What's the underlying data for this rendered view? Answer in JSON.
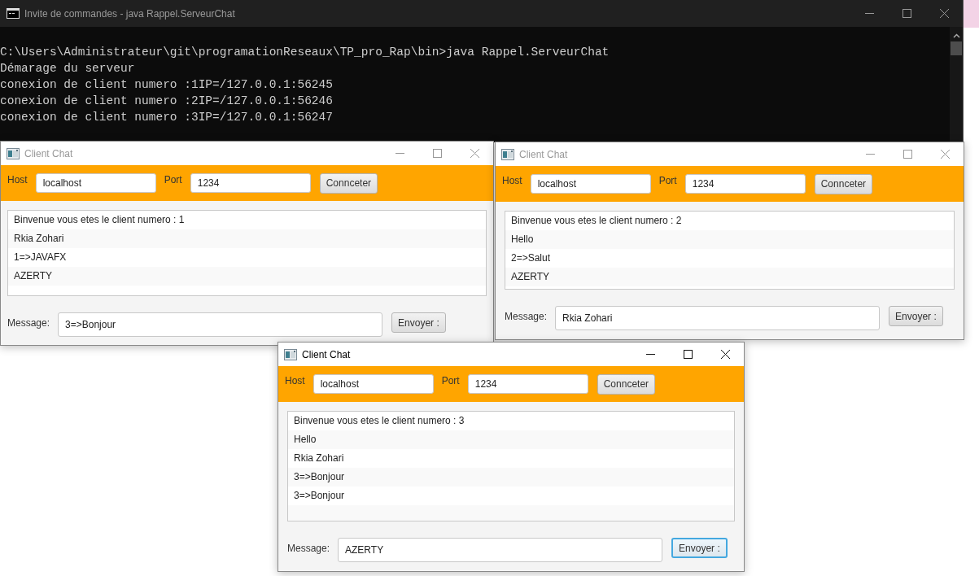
{
  "console": {
    "title": "Invite de commandes - java  Rappel.ServeurChat",
    "lines": [
      "C:\\Users\\Administrateur\\git\\programationReseaux\\TP_pro_Rap\\bin>java Rappel.ServeurChat",
      "Démarage du serveur",
      "conexion de client numero :1IP=/127.0.0.1:56245",
      "conexion de client numero :2IP=/127.0.0.1:56246",
      "conexion de client numero :3IP=/127.0.0.1:56247"
    ]
  },
  "windows": [
    {
      "title": "Client Chat",
      "active": false,
      "host_label": "Host",
      "host": "localhost",
      "port_label": "Port",
      "port": "1234",
      "connect_button": "Connceter",
      "messages": [
        "Binvenue vous etes le client numero : 1",
        "Rkia Zohari",
        "1=>JAVAFX",
        "AZERTY"
      ],
      "message_label": "Message:",
      "message": "3=>Bonjour",
      "send_button": "Envoyer :",
      "send_focused": false
    },
    {
      "title": "Client Chat",
      "active": false,
      "host_label": "Host",
      "host": "localhost",
      "port_label": "Port",
      "port": "1234",
      "connect_button": "Connceter",
      "messages": [
        "Binvenue vous etes le client numero : 2",
        "Hello",
        "2=>Salut",
        "AZERTY"
      ],
      "message_label": "Message:",
      "message": "Rkia Zohari",
      "send_button": "Envoyer :",
      "send_focused": false
    },
    {
      "title": "Client Chat",
      "active": true,
      "host_label": "Host",
      "host": "localhost",
      "port_label": "Port",
      "port": "1234",
      "connect_button": "Connceter",
      "messages": [
        "Binvenue vous etes le client numero : 3",
        "Hello",
        "Rkia Zohari",
        "3=>Bonjour",
        "3=>Bonjour"
      ],
      "message_label": "Message:",
      "message": "AZERTY",
      "send_button": "Envoyer :",
      "send_focused": true
    }
  ]
}
